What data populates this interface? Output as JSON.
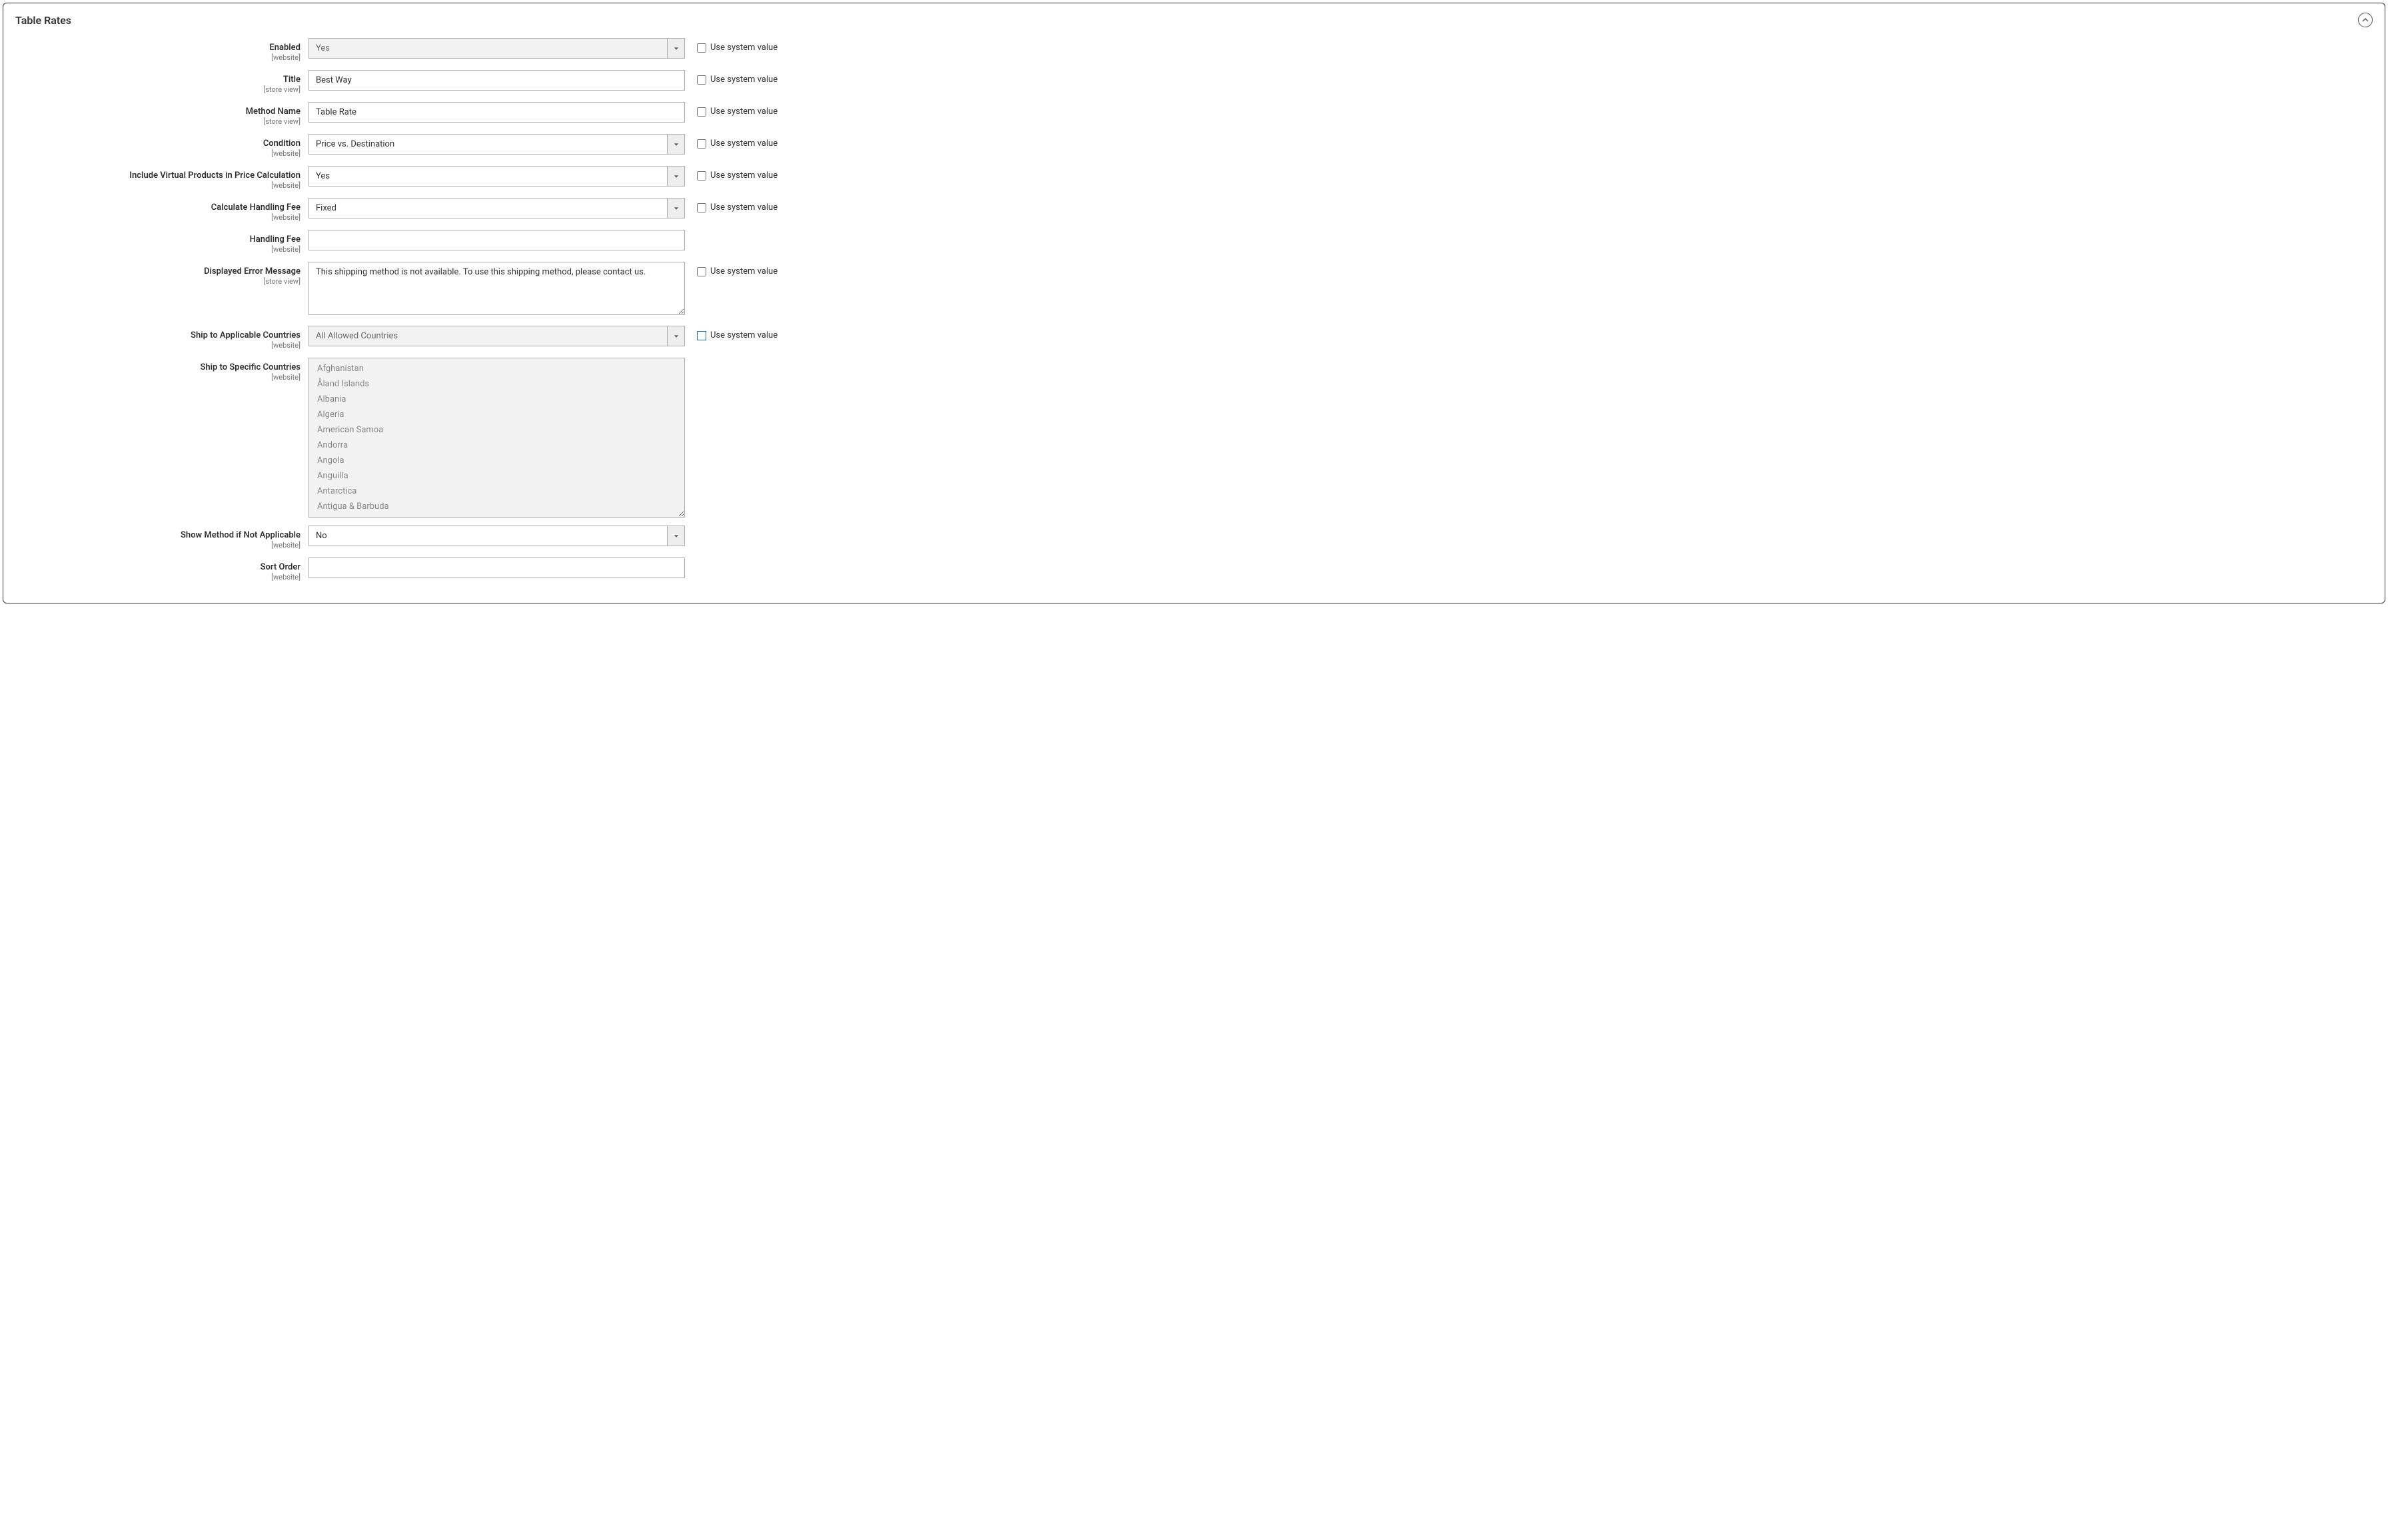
{
  "section_title": "Table Rates",
  "scope_website": "[website]",
  "scope_store_view": "[store view]",
  "use_system_value_label": "Use system value",
  "fields": {
    "enabled": {
      "label": "Enabled",
      "value": "Yes",
      "scope": "website",
      "sysval": false
    },
    "title": {
      "label": "Title",
      "value": "Best Way",
      "scope": "store_view",
      "sysval": false
    },
    "method_name": {
      "label": "Method Name",
      "value": "Table Rate",
      "scope": "store_view",
      "sysval": false
    },
    "condition": {
      "label": "Condition",
      "value": "Price vs. Destination",
      "scope": "website",
      "sysval": false
    },
    "include_virtual": {
      "label": "Include Virtual Products in Price Calculation",
      "value": "Yes",
      "scope": "website",
      "sysval": false
    },
    "calc_handling_fee": {
      "label": "Calculate Handling Fee",
      "value": "Fixed",
      "scope": "website",
      "sysval": false
    },
    "handling_fee": {
      "label": "Handling Fee",
      "value": "",
      "scope": "website"
    },
    "error_message": {
      "label": "Displayed Error Message",
      "value": "This shipping method is not available. To use this shipping method, please contact us.",
      "scope": "store_view",
      "sysval": false
    },
    "ship_applicable": {
      "label": "Ship to Applicable Countries",
      "value": "All Allowed Countries",
      "scope": "website",
      "sysval": false,
      "sysval_highlight": true
    },
    "ship_specific": {
      "label": "Ship to Specific Countries",
      "scope": "website"
    },
    "show_method": {
      "label": "Show Method if Not Applicable",
      "value": "No",
      "scope": "website"
    },
    "sort_order": {
      "label": "Sort Order",
      "value": "",
      "scope": "website"
    }
  },
  "countries": [
    "Afghanistan",
    "Åland Islands",
    "Albania",
    "Algeria",
    "American Samoa",
    "Andorra",
    "Angola",
    "Anguilla",
    "Antarctica",
    "Antigua & Barbuda"
  ]
}
